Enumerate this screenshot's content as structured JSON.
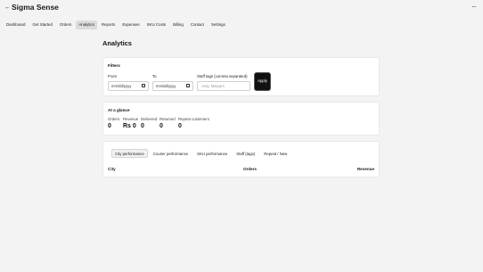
{
  "app": {
    "title": "Sigma Sense",
    "back_icon": "←",
    "menu_icon": "···"
  },
  "nav": {
    "items": [
      {
        "label": "Dashboard",
        "active": false
      },
      {
        "label": "Get Started",
        "active": false
      },
      {
        "label": "Orders",
        "active": false
      },
      {
        "label": "Analytics",
        "active": true
      },
      {
        "label": "Reports",
        "active": false
      },
      {
        "label": "Expenses",
        "active": false
      },
      {
        "label": "SKU Costs",
        "active": false
      },
      {
        "label": "Billing",
        "active": false
      },
      {
        "label": "Contact",
        "active": false
      },
      {
        "label": "Settings",
        "active": false
      }
    ]
  },
  "page": {
    "title": "Analytics"
  },
  "filters": {
    "title": "Filters",
    "from_label": "From",
    "from_value": "mm/dd/yyyy",
    "to_label": "To",
    "to_value": "mm/dd/yyyy",
    "tags_label": "Staff tags (comma separated)",
    "tags_placeholder": "Anoj, Maryam",
    "apply_label": "Apply"
  },
  "glance": {
    "title": "At a glance",
    "metrics": [
      {
        "label": "Orders",
        "value": "0"
      },
      {
        "label": "Revenue",
        "value": "Rs 0"
      },
      {
        "label": "Delivered",
        "value": "0"
      },
      {
        "label": "Returned",
        "value": "0"
      },
      {
        "label": "Repeat customers",
        "value": "0"
      }
    ]
  },
  "performance": {
    "tabs": [
      {
        "label": "City performance",
        "active": true
      },
      {
        "label": "Courier performance",
        "active": false
      },
      {
        "label": "SKU performance",
        "active": false
      },
      {
        "label": "Staff (tags)",
        "active": false
      },
      {
        "label": "Repeat / New",
        "active": false
      }
    ],
    "columns": [
      "City",
      "Orders",
      "Revenue"
    ]
  },
  "colors": {
    "background": "#f3f3f3",
    "card": "#ffffff",
    "active_nav": "#dcdcdc",
    "primary_button": "#111111"
  }
}
